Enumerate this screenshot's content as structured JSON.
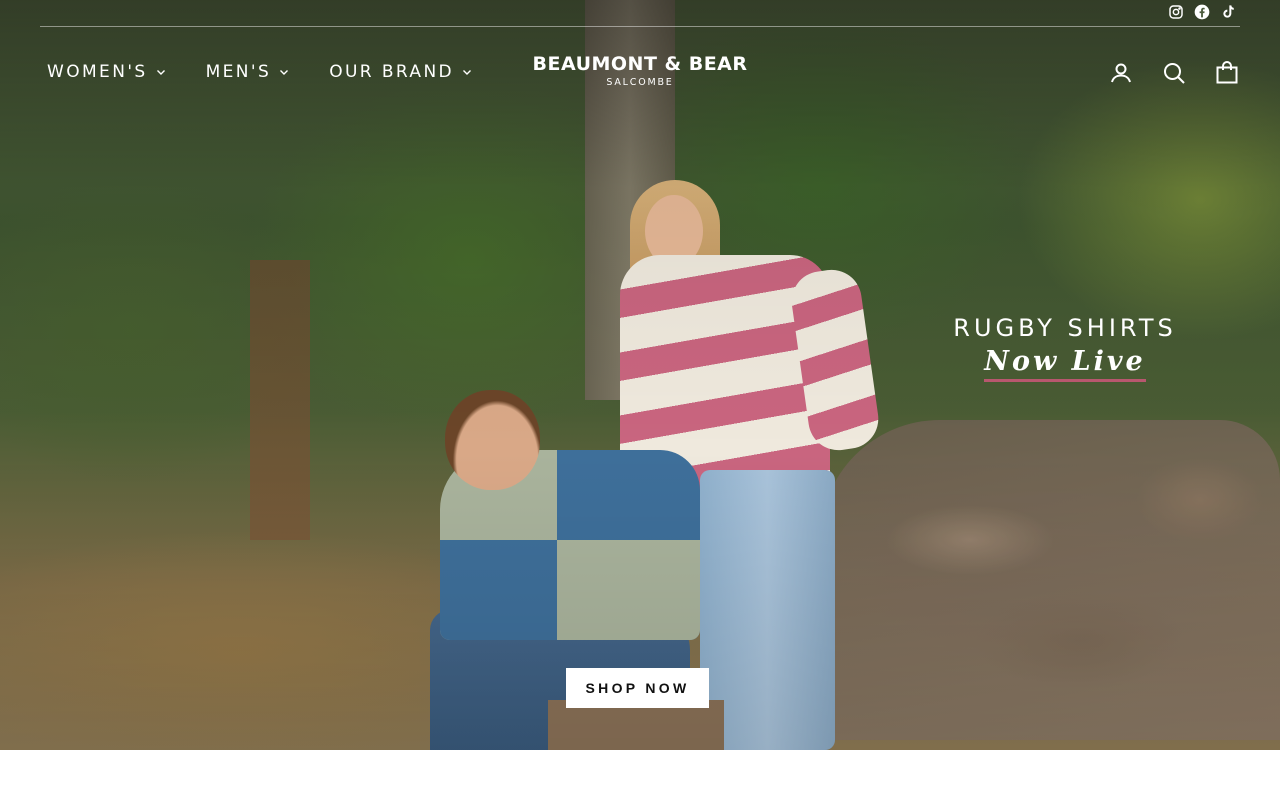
{
  "social": [
    {
      "name": "instagram-icon",
      "label": "Instagram"
    },
    {
      "name": "facebook-icon",
      "label": "Facebook"
    },
    {
      "name": "tiktok-icon",
      "label": "TikTok"
    }
  ],
  "nav": {
    "items": [
      {
        "label": "WOMEN'S"
      },
      {
        "label": "MEN'S"
      },
      {
        "label": "OUR BRAND"
      }
    ]
  },
  "brand": {
    "name": "BEAUMONT & BEAR",
    "location": "SALCOMBE"
  },
  "header_tools": {
    "account_icon": "user-icon",
    "search_icon": "search-icon",
    "cart_icon": "bag-icon"
  },
  "hero": {
    "heading": "RUGBY SHIRTS",
    "subheading": "Now Live",
    "cta_label": "SHOP NOW",
    "accent_color": "#b8576e"
  }
}
